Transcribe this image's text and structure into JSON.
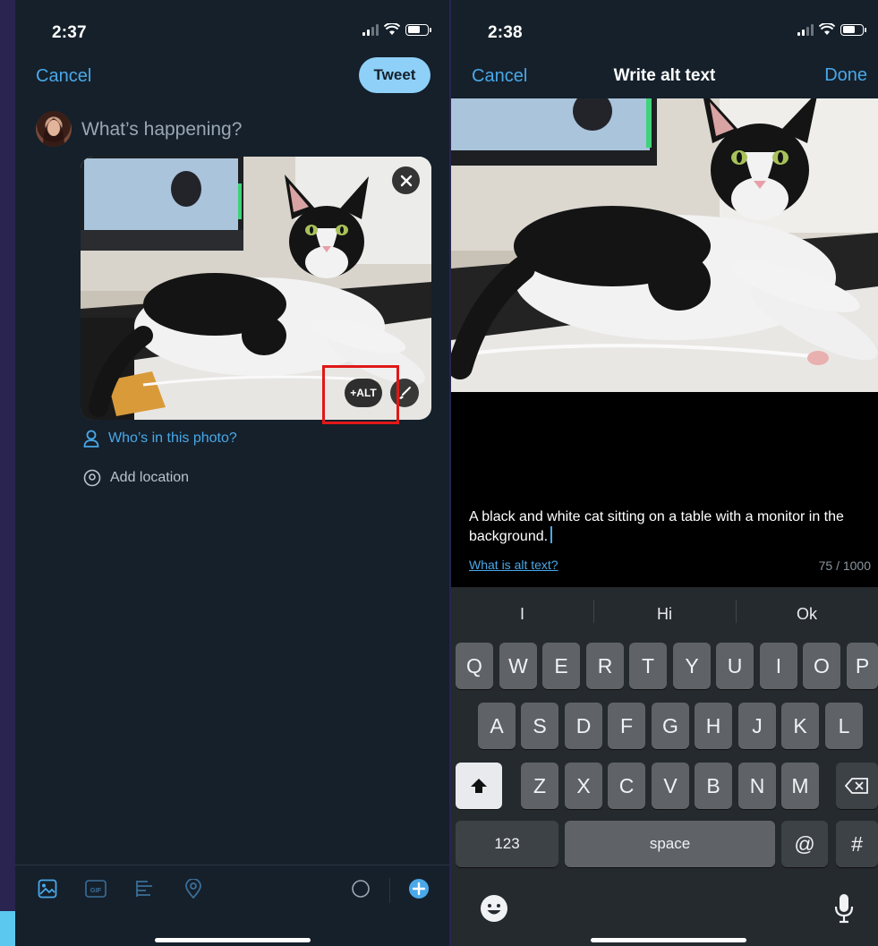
{
  "left": {
    "status": {
      "time": "2:37"
    },
    "nav": {
      "cancel_label": "Cancel",
      "tweet_label": "Tweet"
    },
    "compose": {
      "placeholder": "What’s happening?"
    },
    "media": {
      "alt_label": "+ALT"
    },
    "meta": {
      "tag_people": "Who’s in this photo?",
      "add_location": "Add location"
    },
    "toolbar": {
      "gif_label": "GIF"
    }
  },
  "right": {
    "status": {
      "time": "2:38"
    },
    "nav": {
      "cancel_label": "Cancel",
      "title": "Write alt text",
      "done_label": "Done"
    },
    "alt_text": {
      "value": "A black and white cat sitting on a table with a monitor in the background.",
      "help_link": "What is alt text?",
      "char_count": "75 / 1000"
    },
    "keyboard": {
      "suggestions": [
        "I",
        "Hi",
        "Ok"
      ],
      "row1": [
        "Q",
        "W",
        "E",
        "R",
        "T",
        "Y",
        "U",
        "I",
        "O",
        "P"
      ],
      "row2": [
        "A",
        "S",
        "D",
        "F",
        "G",
        "H",
        "J",
        "K",
        "L"
      ],
      "row3": [
        "Z",
        "X",
        "C",
        "V",
        "B",
        "N",
        "M"
      ],
      "numbers_label": "123",
      "space_label": "space",
      "at_label": "@",
      "hash_label": "#"
    }
  },
  "colors": {
    "accent": "#4aa8e8",
    "tweet_button": "#8ed0f8",
    "dark_bg": "#15202b",
    "highlight": "#e01818"
  },
  "icons": [
    "image-icon",
    "gif-icon",
    "poll-icon",
    "location-icon",
    "progress-ring-icon",
    "add-thread-icon",
    "close-icon",
    "edit-brush-icon",
    "person-icon",
    "location-pin-icon",
    "shift-icon",
    "backspace-icon",
    "emoji-icon",
    "microphone-icon"
  ]
}
